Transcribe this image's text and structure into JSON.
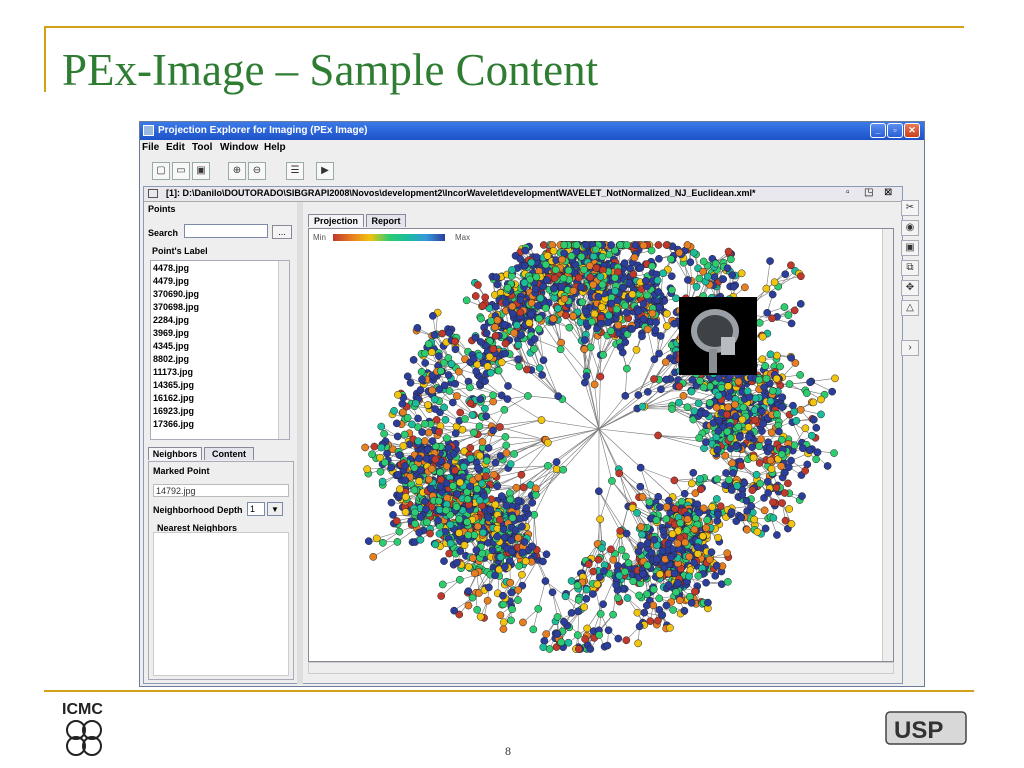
{
  "slide": {
    "title": "PEx-Image – Sample Content",
    "page_number": "8",
    "logo_left": "ICMC",
    "logo_right": "USP"
  },
  "window": {
    "title": "Projection Explorer for Imaging (PEx Image)",
    "menu": [
      "File",
      "Edit",
      "Tool",
      "Window",
      "Help"
    ]
  },
  "internal_frame": {
    "title": "[1]: D:\\Danilo\\DOUTORADO\\SIBGRAPI2008\\Novos\\development2\\IncorWavelet\\developmentWAVELET_NotNormalized_NJ_Euclidean.xml*"
  },
  "left_panel": {
    "points_label": "Points",
    "search_label": "Search",
    "search_button": "...",
    "list_label": "Point's Label",
    "items": [
      "4478.jpg",
      "4479.jpg",
      "370690.jpg",
      "370698.jpg",
      "2284.jpg",
      "3969.jpg",
      "4345.jpg",
      "8802.jpg",
      "11173.jpg",
      "14365.jpg",
      "16162.jpg",
      "16923.jpg",
      "17366.jpg"
    ],
    "tabs": [
      "Neighbors",
      "Content"
    ],
    "marked_point_label": "Marked Point",
    "marked_point_value": "14792.jpg",
    "depth_label": "Neighborhood Depth",
    "depth_value": "1",
    "nearest_label": "Nearest Neighbors"
  },
  "projection": {
    "tabs": [
      "Projection",
      "Report"
    ],
    "min_label": "Min",
    "max_label": "Max",
    "colors": {
      "red": "#c0392b",
      "orange": "#e67e22",
      "yellow": "#f1c40f",
      "green": "#2ecc71",
      "teal": "#1abc9c",
      "blue": "#2c3e9b"
    }
  }
}
